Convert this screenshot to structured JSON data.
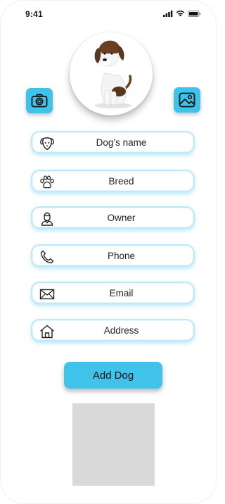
{
  "status": {
    "time": "9:41"
  },
  "form": {
    "fields": [
      {
        "label": "Dog’s name",
        "icon": "dog-face-icon"
      },
      {
        "label": "Breed",
        "icon": "paw-icon"
      },
      {
        "label": "Owner",
        "icon": "person-icon"
      },
      {
        "label": "Phone",
        "icon": "phone-icon"
      },
      {
        "label": "Email",
        "icon": "envelope-icon"
      },
      {
        "label": "Address",
        "icon": "house-icon"
      }
    ],
    "submit_label": "Add Dog"
  },
  "colors": {
    "accent": "#3fc3ea",
    "field_border": "#bfe8f8",
    "placeholder": "#d9d9d9"
  }
}
